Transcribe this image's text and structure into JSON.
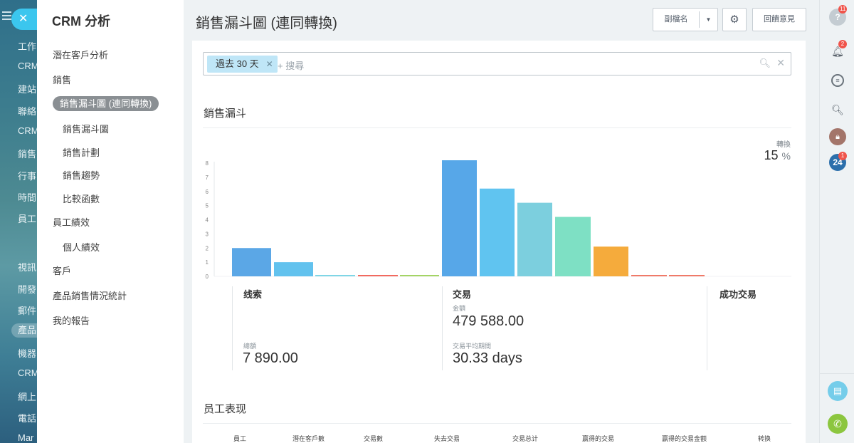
{
  "left_strip": {
    "items": [
      "工作",
      "CRM",
      "建站",
      "聯絡",
      "CRM",
      "銷售",
      "行事",
      "時間",
      "員工",
      "視訊",
      "開發",
      "郵件",
      "產品",
      "機器",
      "CRM",
      "網上",
      "電話",
      "Mar"
    ]
  },
  "nav": {
    "title": "CRM 分析",
    "items": [
      "潛在客戶分析",
      "銷售",
      "銷售漏斗圖 (連同轉換)",
      "銷售漏斗圖",
      "銷售計劃",
      "銷售趨勢",
      "比較函數",
      "員工績效",
      "個人績效",
      "客戶",
      "產品銷售情況統計",
      "我的報告"
    ]
  },
  "header": {
    "title": "銷售漏斗圖 (連同轉換)",
    "btn_name": "副檔名",
    "btn_feedback": "回饋意見"
  },
  "filter": {
    "tag": "過去 30 天",
    "placeholder": "+ 搜尋"
  },
  "section1": {
    "title": "銷售漏斗"
  },
  "conversion": {
    "label": "轉換",
    "value": "15",
    "unit": "%"
  },
  "chart_data": {
    "type": "bar",
    "title": "",
    "xlabel": "",
    "ylabel": "",
    "ylim": [
      0,
      8
    ],
    "yticks": [
      0,
      1,
      2,
      3,
      4,
      5,
      6,
      7,
      8
    ],
    "values": [
      2,
      1,
      0,
      0,
      0,
      8.2,
      6.2,
      5.2,
      4.2,
      2.1,
      0,
      0
    ],
    "colors": [
      "#5ba7e6",
      "#62c2ee",
      "#7fd6e6",
      "#f26a5f",
      "#a4d465",
      "#57a7e8",
      "#60c4f0",
      "#7ccfde",
      "#7ee0c4",
      "#f5ab3c",
      "#f07a68",
      "#f07a68"
    ],
    "grid": false,
    "legend": "none"
  },
  "stats": {
    "col1_title": "线索",
    "col1_label": "總額",
    "col1_value": "7 890.00",
    "col2_title": "交易",
    "col2_label1": "金額",
    "col2_value1": "479 588.00",
    "col2_label2": "交易平均期間",
    "col2_value2": "30.33 days",
    "col3_title": "成功交易"
  },
  "section2": {
    "title": "员工表现"
  },
  "table": {
    "headers": [
      "員工",
      "潛在客戶數",
      "交易數",
      "失去交易",
      "交易总计",
      "赢得的交易",
      "赢得的交易金额",
      "转换"
    ]
  },
  "rbar": {
    "badge_help": "11",
    "badge_notify": "2",
    "badge_24": "1",
    "label_24": "24"
  }
}
